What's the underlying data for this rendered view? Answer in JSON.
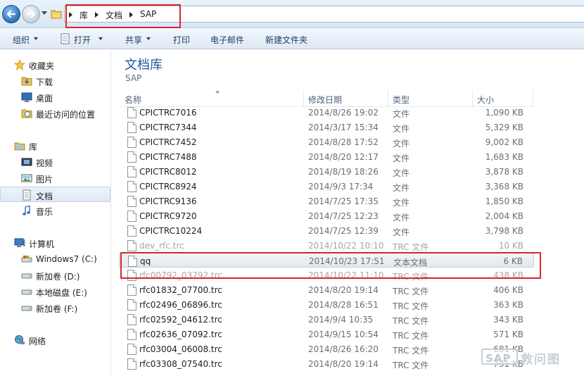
{
  "address": {
    "crumbs": [
      "库",
      "文档",
      "SAP"
    ]
  },
  "toolbar": {
    "organize": "组织",
    "open": "打开",
    "share": "共享",
    "print": "打印",
    "email": "电子邮件",
    "new_folder": "新建文件夹"
  },
  "nav": {
    "favorites": "收藏夹",
    "downloads": "下载",
    "desktop": "桌面",
    "recent": "最近访问的位置",
    "libraries": "库",
    "videos": "视频",
    "pictures": "图片",
    "documents": "文档",
    "music": "音乐",
    "computer": "计算机",
    "drive_c": "Windows7 (C:)",
    "drive_d": "新加卷 (D:)",
    "drive_e": "本地磁盘 (E:)",
    "drive_f": "新加卷 (F:)",
    "network": "网络"
  },
  "library": {
    "title": "文档库",
    "subtitle": "SAP"
  },
  "columns": {
    "name": "名称",
    "date": "修改日期",
    "type": "类型",
    "size": "大小"
  },
  "files": [
    {
      "name": "CPICTRC7016",
      "date": "2014/8/26 19:02",
      "type": "文件",
      "size": "1,090 KB"
    },
    {
      "name": "CPICTRC7344",
      "date": "2014/3/17 15:34",
      "type": "文件",
      "size": "5,329 KB"
    },
    {
      "name": "CPICTRC7452",
      "date": "2014/8/28 17:52",
      "type": "文件",
      "size": "9,002 KB"
    },
    {
      "name": "CPICTRC7488",
      "date": "2014/8/20 12:17",
      "type": "文件",
      "size": "1,683 KB"
    },
    {
      "name": "CPICTRC8012",
      "date": "2014/8/19 18:26",
      "type": "文件",
      "size": "3,878 KB"
    },
    {
      "name": "CPICTRC8924",
      "date": "2014/9/3 17:34",
      "type": "文件",
      "size": "3,368 KB"
    },
    {
      "name": "CPICTRC9136",
      "date": "2014/7/25 17:35",
      "type": "文件",
      "size": "1,850 KB"
    },
    {
      "name": "CPICTRC9720",
      "date": "2014/7/25 12:23",
      "type": "文件",
      "size": "2,004 KB"
    },
    {
      "name": "CPICTRC10224",
      "date": "2014/7/25 12:39",
      "type": "文件",
      "size": "3,798 KB"
    },
    {
      "name": "dev_rfc.trc",
      "date": "2014/10/22 10:10",
      "type": "TRC 文件",
      "size": "10 KB"
    },
    {
      "name": "qq",
      "date": "2014/10/23 17:51",
      "type": "文本文档",
      "size": "6 KB"
    },
    {
      "name": "rfc00792_03792.trc",
      "date": "2014/10/22 11:10",
      "type": "TRC 文件",
      "size": "438 KB"
    },
    {
      "name": "rfc01832_07700.trc",
      "date": "2014/8/20 19:14",
      "type": "TRC 文件",
      "size": "406 KB"
    },
    {
      "name": "rfc02496_06896.trc",
      "date": "2014/8/28 16:51",
      "type": "TRC 文件",
      "size": "363 KB"
    },
    {
      "name": "rfc02592_04612.trc",
      "date": "2014/9/4 10:35",
      "type": "TRC 文件",
      "size": "343 KB"
    },
    {
      "name": "rfc02636_07092.trc",
      "date": "2014/9/15 10:54",
      "type": "TRC 文件",
      "size": "571 KB"
    },
    {
      "name": "rfc03004_06008.trc",
      "date": "2014/8/26 16:20",
      "type": "TRC 文件",
      "size": "681 KB"
    },
    {
      "name": "rfc03308_07540.trc",
      "date": "2014/8/20 19:14",
      "type": "TRC 文件",
      "size": "731 KB"
    }
  ],
  "watermark": {
    "brand": "SAP",
    "text": "救问图"
  },
  "colors": {
    "highlight": "#d8262b",
    "library_title": "#1e5b99"
  }
}
